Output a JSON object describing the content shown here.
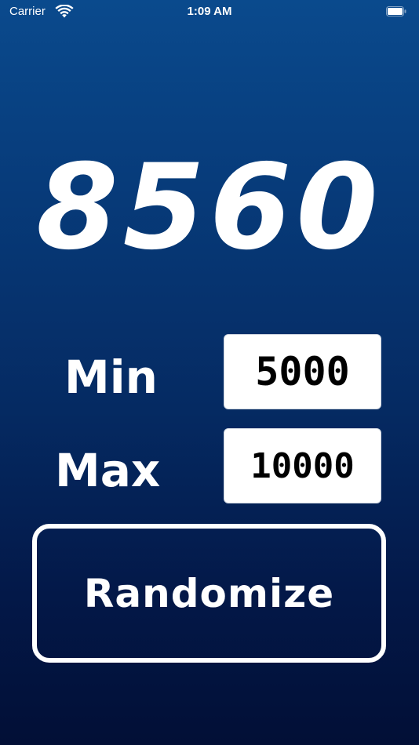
{
  "status_bar": {
    "carrier": "Carrier",
    "time": "1:09 AM",
    "icons": [
      "wifi-icon",
      "battery-icon"
    ]
  },
  "result": {
    "value": "8560"
  },
  "range": {
    "min_label": "Min",
    "min_value": "5000",
    "max_label": "Max",
    "max_value": "10000"
  },
  "actions": {
    "randomize_label": "Randomize"
  },
  "colors": {
    "background_top": "#0a4a8d",
    "background_bottom": "#020f36",
    "text": "#ffffff",
    "field_background": "#ffffff",
    "field_text": "#000000"
  }
}
